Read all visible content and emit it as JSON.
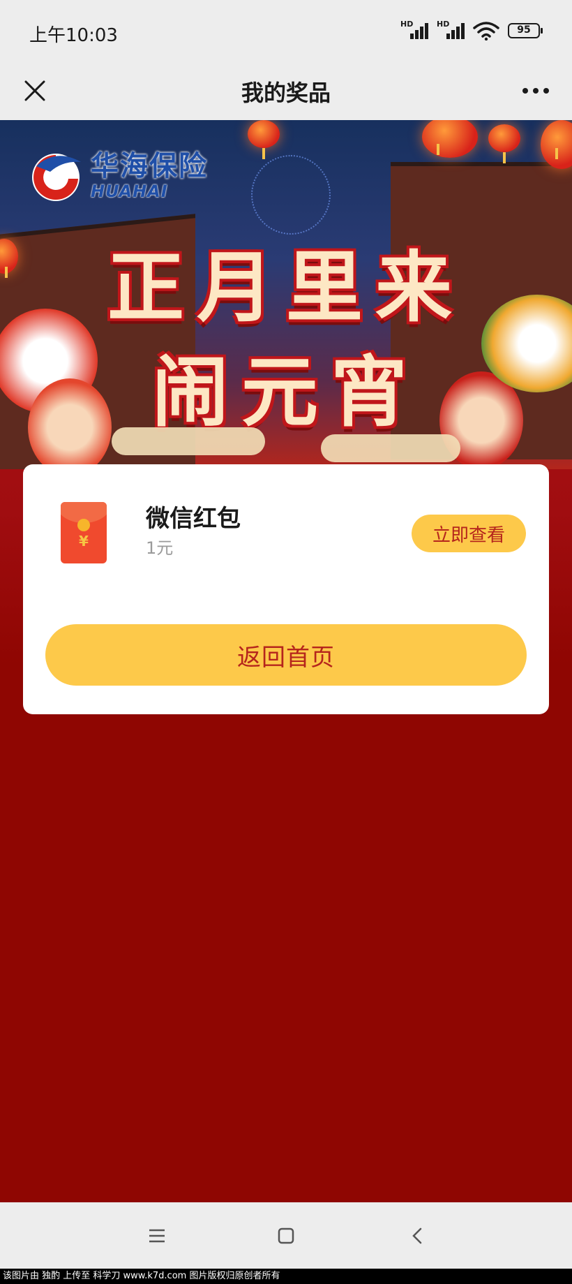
{
  "status_bar": {
    "time": "上午10:03",
    "signal1": "HD",
    "signal2": "HD",
    "battery": "95"
  },
  "header": {
    "title": "我的奖品"
  },
  "banner": {
    "brand_cn": "华海保险",
    "brand_en": "HUAHAI",
    "headline_line1": "正月里来",
    "headline_line2": "闹元宵"
  },
  "prize": {
    "name": "微信红包",
    "value": "1元",
    "view_label": "立即查看",
    "icon": "red-envelope-icon"
  },
  "home_button_label": "返回首页",
  "watermark": "该图片由 独酌 上传至 科学刀 www.k7d.com 图片版权归原创者所有",
  "colors": {
    "accent": "#fdc94a",
    "accent_text": "#b5251c",
    "background": "#8f0602"
  }
}
